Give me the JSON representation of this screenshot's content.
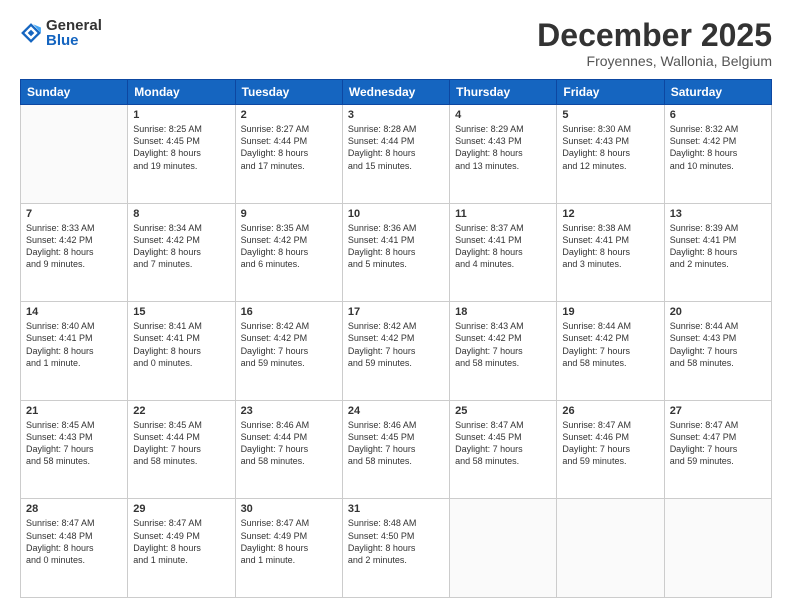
{
  "logo": {
    "general": "General",
    "blue": "Blue"
  },
  "title": "December 2025",
  "location": "Froyennes, Wallonia, Belgium",
  "headers": [
    "Sunday",
    "Monday",
    "Tuesday",
    "Wednesday",
    "Thursday",
    "Friday",
    "Saturday"
  ],
  "weeks": [
    [
      {
        "day": "",
        "info": ""
      },
      {
        "day": "1",
        "info": "Sunrise: 8:25 AM\nSunset: 4:45 PM\nDaylight: 8 hours\nand 19 minutes."
      },
      {
        "day": "2",
        "info": "Sunrise: 8:27 AM\nSunset: 4:44 PM\nDaylight: 8 hours\nand 17 minutes."
      },
      {
        "day": "3",
        "info": "Sunrise: 8:28 AM\nSunset: 4:44 PM\nDaylight: 8 hours\nand 15 minutes."
      },
      {
        "day": "4",
        "info": "Sunrise: 8:29 AM\nSunset: 4:43 PM\nDaylight: 8 hours\nand 13 minutes."
      },
      {
        "day": "5",
        "info": "Sunrise: 8:30 AM\nSunset: 4:43 PM\nDaylight: 8 hours\nand 12 minutes."
      },
      {
        "day": "6",
        "info": "Sunrise: 8:32 AM\nSunset: 4:42 PM\nDaylight: 8 hours\nand 10 minutes."
      }
    ],
    [
      {
        "day": "7",
        "info": "Sunrise: 8:33 AM\nSunset: 4:42 PM\nDaylight: 8 hours\nand 9 minutes."
      },
      {
        "day": "8",
        "info": "Sunrise: 8:34 AM\nSunset: 4:42 PM\nDaylight: 8 hours\nand 7 minutes."
      },
      {
        "day": "9",
        "info": "Sunrise: 8:35 AM\nSunset: 4:42 PM\nDaylight: 8 hours\nand 6 minutes."
      },
      {
        "day": "10",
        "info": "Sunrise: 8:36 AM\nSunset: 4:41 PM\nDaylight: 8 hours\nand 5 minutes."
      },
      {
        "day": "11",
        "info": "Sunrise: 8:37 AM\nSunset: 4:41 PM\nDaylight: 8 hours\nand 4 minutes."
      },
      {
        "day": "12",
        "info": "Sunrise: 8:38 AM\nSunset: 4:41 PM\nDaylight: 8 hours\nand 3 minutes."
      },
      {
        "day": "13",
        "info": "Sunrise: 8:39 AM\nSunset: 4:41 PM\nDaylight: 8 hours\nand 2 minutes."
      }
    ],
    [
      {
        "day": "14",
        "info": "Sunrise: 8:40 AM\nSunset: 4:41 PM\nDaylight: 8 hours\nand 1 minute."
      },
      {
        "day": "15",
        "info": "Sunrise: 8:41 AM\nSunset: 4:41 PM\nDaylight: 8 hours\nand 0 minutes."
      },
      {
        "day": "16",
        "info": "Sunrise: 8:42 AM\nSunset: 4:42 PM\nDaylight: 7 hours\nand 59 minutes."
      },
      {
        "day": "17",
        "info": "Sunrise: 8:42 AM\nSunset: 4:42 PM\nDaylight: 7 hours\nand 59 minutes."
      },
      {
        "day": "18",
        "info": "Sunrise: 8:43 AM\nSunset: 4:42 PM\nDaylight: 7 hours\nand 58 minutes."
      },
      {
        "day": "19",
        "info": "Sunrise: 8:44 AM\nSunset: 4:42 PM\nDaylight: 7 hours\nand 58 minutes."
      },
      {
        "day": "20",
        "info": "Sunrise: 8:44 AM\nSunset: 4:43 PM\nDaylight: 7 hours\nand 58 minutes."
      }
    ],
    [
      {
        "day": "21",
        "info": "Sunrise: 8:45 AM\nSunset: 4:43 PM\nDaylight: 7 hours\nand 58 minutes."
      },
      {
        "day": "22",
        "info": "Sunrise: 8:45 AM\nSunset: 4:44 PM\nDaylight: 7 hours\nand 58 minutes."
      },
      {
        "day": "23",
        "info": "Sunrise: 8:46 AM\nSunset: 4:44 PM\nDaylight: 7 hours\nand 58 minutes."
      },
      {
        "day": "24",
        "info": "Sunrise: 8:46 AM\nSunset: 4:45 PM\nDaylight: 7 hours\nand 58 minutes."
      },
      {
        "day": "25",
        "info": "Sunrise: 8:47 AM\nSunset: 4:45 PM\nDaylight: 7 hours\nand 58 minutes."
      },
      {
        "day": "26",
        "info": "Sunrise: 8:47 AM\nSunset: 4:46 PM\nDaylight: 7 hours\nand 59 minutes."
      },
      {
        "day": "27",
        "info": "Sunrise: 8:47 AM\nSunset: 4:47 PM\nDaylight: 7 hours\nand 59 minutes."
      }
    ],
    [
      {
        "day": "28",
        "info": "Sunrise: 8:47 AM\nSunset: 4:48 PM\nDaylight: 8 hours\nand 0 minutes."
      },
      {
        "day": "29",
        "info": "Sunrise: 8:47 AM\nSunset: 4:49 PM\nDaylight: 8 hours\nand 1 minute."
      },
      {
        "day": "30",
        "info": "Sunrise: 8:47 AM\nSunset: 4:49 PM\nDaylight: 8 hours\nand 1 minute."
      },
      {
        "day": "31",
        "info": "Sunrise: 8:48 AM\nSunset: 4:50 PM\nDaylight: 8 hours\nand 2 minutes."
      },
      {
        "day": "",
        "info": ""
      },
      {
        "day": "",
        "info": ""
      },
      {
        "day": "",
        "info": ""
      }
    ]
  ]
}
